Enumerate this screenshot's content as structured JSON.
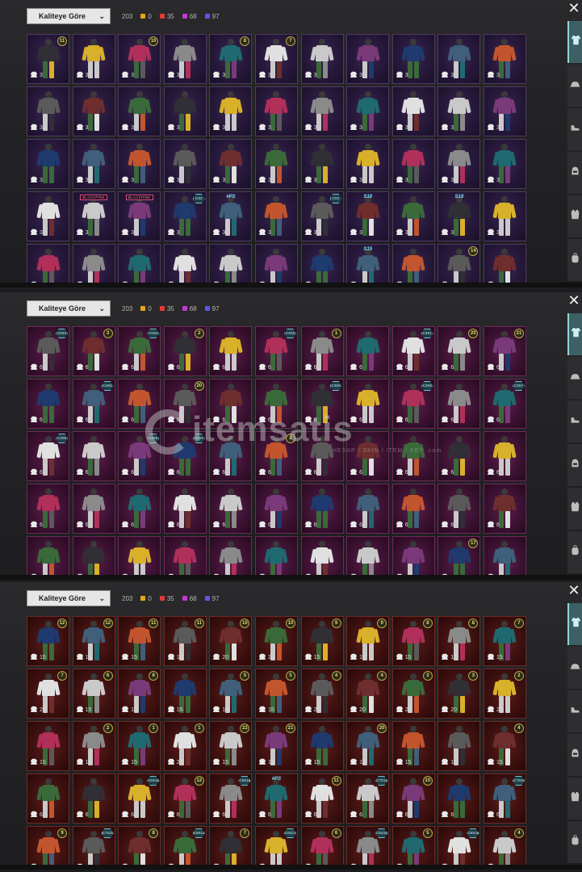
{
  "toolbar": {
    "sort_label": "Kaliteye Göre",
    "total_count": "203",
    "quality_counts": [
      {
        "color": "#e8a419",
        "value": "0"
      },
      {
        "color": "#e23b3b",
        "value": "35"
      },
      {
        "color": "#c23ad6",
        "value": "68"
      },
      {
        "color": "#5b56e8",
        "value": "97"
      }
    ]
  },
  "sidebar_tabs": [
    "outfit-icon",
    "hat-icon",
    "shoe-icon",
    "helmet-icon",
    "vest-icon",
    "backpack-icon"
  ],
  "watermark": {
    "text": "itemsatis",
    "subtext": "HESAP / SKIN / ITEM / KEY .com"
  },
  "panels": [
    {
      "tone": "purple",
      "rows": [
        [
          {
            "n": "3",
            "b": "11"
          },
          {
            "n": "3"
          },
          {
            "n": "3",
            "b": "10"
          },
          {
            "n": "3"
          },
          {
            "n": "3",
            "b": "8"
          },
          {
            "n": "3",
            "b": "7"
          },
          {
            "n": "3"
          },
          {
            "n": "3"
          },
          {
            "n": "3"
          },
          {
            "n": "3"
          },
          {
            "n": "3"
          }
        ],
        [
          {
            "n": "3"
          },
          {
            "n": "3"
          },
          {
            "n": "3"
          },
          {
            "n": "3"
          },
          {
            "n": "3"
          },
          {
            "n": "3"
          },
          {
            "n": "3"
          },
          {
            "n": "3"
          },
          {
            "n": "3"
          },
          {
            "n": "3"
          },
          {
            "n": "3"
          }
        ],
        [
          {
            "n": "3"
          },
          {
            "n": "3"
          },
          {
            "n": "3"
          },
          {
            "n": "3"
          },
          {
            "n": "3"
          },
          {
            "n": "3"
          },
          {
            "n": "3"
          },
          {
            "n": "3"
          },
          {
            "n": "3"
          },
          {
            "n": "3"
          },
          {
            "n": "3"
          }
        ],
        [
          {
            "n": "3"
          },
          {
            "n": "3",
            "p": "BLACKPINK"
          },
          {
            "n": "3",
            "p": "BLACKPINK"
          },
          {
            "n": "3",
            "h": "CS2"
          },
          {
            "n": "3",
            "t": "#PS"
          },
          {
            "n": "3"
          },
          {
            "n": "3",
            "h": "CS1"
          },
          {
            "n": "3",
            "t": "S18"
          },
          {
            "n": "3"
          },
          {
            "n": "3",
            "t": "S18"
          },
          {
            "n": "3"
          }
        ],
        [
          {
            "n": ""
          },
          {
            "n": ""
          },
          {
            "n": ""
          },
          {
            "n": ""
          },
          {
            "n": ""
          },
          {
            "n": ""
          },
          {
            "n": ""
          },
          {
            "n": "",
            "t": "S15"
          },
          {
            "n": ""
          },
          {
            "n": "",
            "b": "14"
          },
          {
            "n": ""
          }
        ]
      ]
    },
    {
      "tone": "pink",
      "rows": [
        [
          {
            "n": "6",
            "h": "C6S4"
          },
          {
            "n": "6",
            "b": "3"
          },
          {
            "n": "6",
            "h": "C5S3"
          },
          {
            "n": "6",
            "b": "2"
          },
          {
            "n": "6"
          },
          {
            "n": "6",
            "h": "C4S3"
          },
          {
            "n": "6",
            "b": "1"
          },
          {
            "n": "6"
          },
          {
            "n": "6",
            "h": "C4S1"
          },
          {
            "n": "6",
            "b": "20"
          },
          {
            "n": "6",
            "b": "21"
          }
        ],
        [
          {
            "n": "6"
          },
          {
            "n": "6",
            "h": "C4S6"
          },
          {
            "n": "6"
          },
          {
            "n": "6",
            "b": "20"
          },
          {
            "n": "6"
          },
          {
            "n": "6"
          },
          {
            "n": "6",
            "h": "C3S9"
          },
          {
            "n": "6"
          },
          {
            "n": "6",
            "h": "C3S8"
          },
          {
            "n": "6"
          },
          {
            "n": "6",
            "h": "C3S7"
          }
        ],
        [
          {
            "n": "6",
            "h": "C2S5"
          },
          {
            "n": "6"
          },
          {
            "n": "6",
            "h": "C2S6"
          },
          {
            "n": "6",
            "h": "C2S4"
          },
          {
            "n": "6"
          },
          {
            "n": "6",
            "b": "2"
          },
          {
            "n": "6"
          },
          {
            "n": "6"
          },
          {
            "n": "6"
          },
          {
            "n": "6"
          },
          {
            "n": "6"
          }
        ],
        [
          {
            "n": "6"
          },
          {
            "n": "6"
          },
          {
            "n": "6"
          },
          {
            "n": "6"
          },
          {
            "n": "6"
          },
          {
            "n": "6"
          },
          {
            "n": "6"
          },
          {
            "n": "6"
          },
          {
            "n": "6"
          },
          {
            "n": "6"
          },
          {
            "n": "6"
          }
        ],
        [
          {
            "n": ""
          },
          {
            "n": ""
          },
          {
            "n": ""
          },
          {
            "n": ""
          },
          {
            "n": ""
          },
          {
            "n": ""
          },
          {
            "n": ""
          },
          {
            "n": ""
          },
          {
            "n": ""
          },
          {
            "n": "",
            "b": "17"
          },
          {
            "n": ""
          }
        ]
      ]
    },
    {
      "tone": "red",
      "rows": [
        [
          {
            "n": "15",
            "b": "12"
          },
          {
            "n": "15",
            "b": "12"
          },
          {
            "n": "15",
            "b": "11"
          },
          {
            "n": "15",
            "b": "11"
          },
          {
            "n": "20",
            "b": "10"
          },
          {
            "n": "20",
            "b": "10"
          },
          {
            "n": "15",
            "b": "9"
          },
          {
            "n": "15",
            "b": "9"
          },
          {
            "n": "15",
            "b": "8"
          },
          {
            "n": "17",
            "b": "8"
          },
          {
            "n": "15",
            "b": "7"
          }
        ],
        [
          {
            "n": "20",
            "b": "7"
          },
          {
            "n": "15",
            "b": "6"
          },
          {
            "n": "15",
            "b": "6"
          },
          {
            "n": "15"
          },
          {
            "n": "15",
            "b": "5"
          },
          {
            "n": "15",
            "b": "5"
          },
          {
            "n": "20",
            "b": "4"
          },
          {
            "n": "20",
            "b": "4"
          },
          {
            "n": "20",
            "b": "3"
          },
          {
            "n": "20",
            "b": "3"
          },
          {
            "n": "20",
            "b": "2"
          }
        ],
        [
          {
            "n": "15"
          },
          {
            "n": "15",
            "b": "2"
          },
          {
            "n": "15",
            "b": "1"
          },
          {
            "n": "20",
            "b": "1"
          },
          {
            "n": "15",
            "b": "22"
          },
          {
            "n": "15",
            "b": "21"
          },
          {
            "n": "15"
          },
          {
            "n": "15",
            "b": "20"
          },
          {
            "n": "15"
          },
          {
            "n": "15"
          },
          {
            "n": "15",
            "b": "4"
          }
        ],
        [
          {
            "n": "6"
          },
          {
            "n": "6"
          },
          {
            "n": "6",
            "h": "C6S19"
          },
          {
            "n": "6",
            "b": "12"
          },
          {
            "n": "6",
            "h": "C6S18"
          },
          {
            "n": "6",
            "t": "#PS"
          },
          {
            "n": "6",
            "b": "11"
          },
          {
            "n": "6",
            "h": "C7S13"
          },
          {
            "n": "6",
            "b": "10"
          },
          {
            "n": "6"
          },
          {
            "n": "6",
            "h": "C7S16"
          }
        ],
        [
          {
            "n": "",
            "b": "9"
          },
          {
            "n": "",
            "h": "C7S20"
          },
          {
            "n": "",
            "b": "8"
          },
          {
            "n": "",
            "h": "C6S14"
          },
          {
            "n": "",
            "b": "7"
          },
          {
            "n": "",
            "h": "C6S17"
          },
          {
            "n": "",
            "b": "6"
          },
          {
            "n": "",
            "h": "C6S16"
          },
          {
            "n": "",
            "b": "5"
          },
          {
            "n": "",
            "h": "C6S15"
          },
          {
            "n": "",
            "b": "4"
          }
        ]
      ]
    }
  ]
}
